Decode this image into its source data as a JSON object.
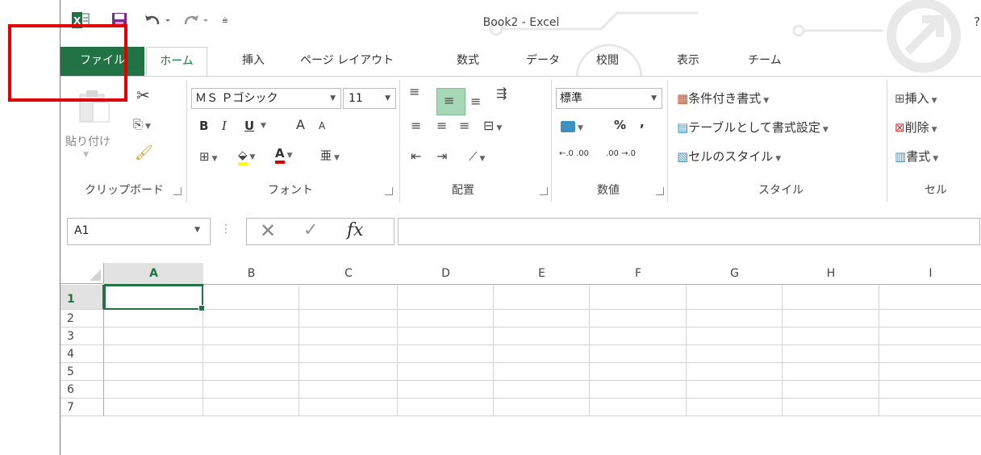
{
  "window": {
    "title": "Book2 - Excel",
    "help": "?"
  },
  "tabs": [
    "ファイル",
    "ホーム",
    "挿入",
    "ページ レイアウト",
    "数式",
    "データ",
    "校閲",
    "表示",
    "チーム"
  ],
  "clipboard": {
    "paste_label": "貼り付け",
    "group_label": "クリップボード"
  },
  "font": {
    "name": "ＭＳ Ｐゴシック",
    "size": "11",
    "bold": "B",
    "italic": "I",
    "underline": "U",
    "grow": "A",
    "shrink": "A",
    "furigana": "亜",
    "group_label": "フォント"
  },
  "alignment": {
    "group_label": "配置"
  },
  "number": {
    "format": "標準",
    "percent": "%",
    "comma": ",",
    "inc_decimal": "←.0 .00",
    "dec_decimal": ".00 →.0",
    "group_label": "数値"
  },
  "styles": {
    "conditional": "条件付き書式",
    "table": "テーブルとして書式設定",
    "cell_styles": "セルのスタイル",
    "group_label": "スタイル"
  },
  "cells": {
    "insert": "挿入",
    "delete": "削除",
    "format": "書式",
    "group_label": "セル"
  },
  "formula_bar": {
    "name_box": "A1",
    "fx": "fx",
    "cancel": "✕",
    "enter": "✓"
  },
  "sheet": {
    "columns": [
      "A",
      "B",
      "C",
      "D",
      "E",
      "F",
      "G",
      "H",
      "I"
    ],
    "rows": [
      "1",
      "2",
      "3",
      "4",
      "5",
      "6",
      "7"
    ],
    "selected_cell": "A1"
  },
  "colors": {
    "accent": "#217346",
    "highlight": "#e00000"
  }
}
